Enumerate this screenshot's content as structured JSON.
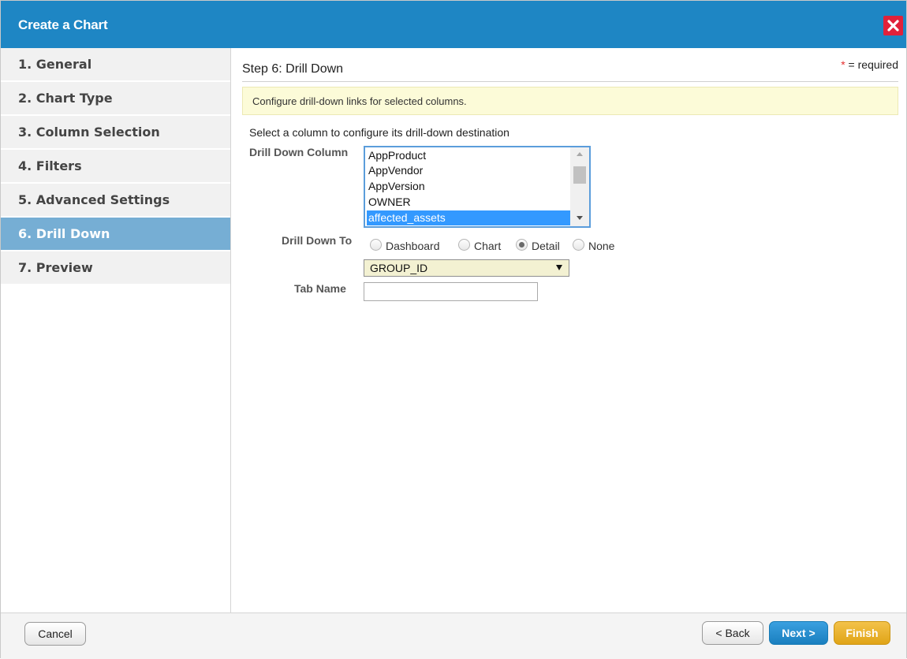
{
  "dialog": {
    "title": "Create a Chart"
  },
  "sidebar": {
    "items": [
      {
        "label": "1. General"
      },
      {
        "label": "2. Chart Type"
      },
      {
        "label": "3. Column Selection"
      },
      {
        "label": "4. Filters"
      },
      {
        "label": "5. Advanced Settings"
      },
      {
        "label": "6. Drill Down",
        "active": true
      },
      {
        "label": "7. Preview"
      }
    ]
  },
  "main": {
    "step_title": "Step 6: Drill Down",
    "required_star": "*",
    "required_text": " = required",
    "info": "Configure drill-down links for selected columns.",
    "instruction": "Select a column to configure its drill-down destination",
    "drill_down_column_label": "Drill Down Column",
    "columns": [
      "AppProduct",
      "AppVendor",
      "AppVersion",
      "OWNER",
      "affected_assets"
    ],
    "selected_column": "affected_assets",
    "drill_down_to_label": "Drill Down To",
    "drill_options": [
      "Dashboard",
      "Chart",
      "Detail",
      "None"
    ],
    "selected_drill_option": "Detail",
    "detail_field": "GROUP_ID",
    "tab_name_label": "Tab Name",
    "tab_name_value": ""
  },
  "footer": {
    "cancel": "Cancel",
    "back": "< Back",
    "next": "Next >",
    "finish": "Finish"
  },
  "colors": {
    "titlebar": "#1e86c4",
    "close": "#e1213a",
    "active_nav": "#76aed4",
    "info_bg": "#fcfbd8",
    "select_bg": "#f3f1d2",
    "next": "#1a7fbf",
    "finish": "#e0a417"
  }
}
